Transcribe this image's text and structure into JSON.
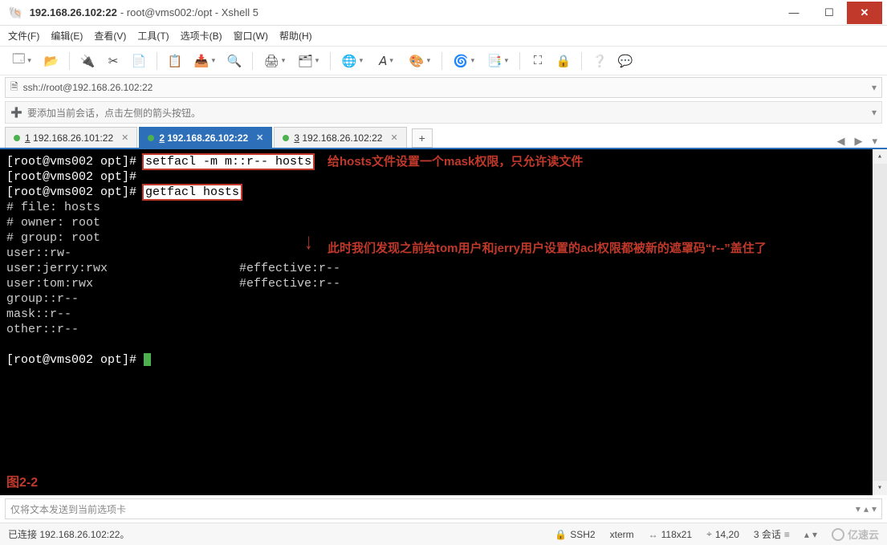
{
  "titlebar": {
    "host": "192.168.26.102:22",
    "subtitle": " - root@vms002:/opt - Xshell 5"
  },
  "menu": {
    "file": "文件(F)",
    "edit": "编辑(E)",
    "view": "查看(V)",
    "tools": "工具(T)",
    "tabs": "选项卡(B)",
    "window": "窗口(W)",
    "help": "帮助(H)"
  },
  "addressbar": {
    "url": "ssh://root@192.168.26.102:22"
  },
  "hintbar": {
    "text": "要添加当前会话，点击左侧的箭头按钮。"
  },
  "tabs": {
    "t0": {
      "prefix": "1",
      "label": " 192.168.26.101:22"
    },
    "t1": {
      "prefix": "2",
      "label": " 192.168.26.102:22"
    },
    "t2": {
      "prefix": "3",
      "label": " 192.168.26.102:22"
    }
  },
  "terminal": {
    "prompt1": "[root@vms002 opt]# ",
    "cmd1": "setfacl -m m::r-- hosts",
    "prompt2": "[root@vms002 opt]#",
    "prompt3": "[root@vms002 opt]# ",
    "cmd3": "getfacl hosts",
    "l_file": "# file: hosts",
    "l_owner": "# owner: root",
    "l_group": "# group: root",
    "l_user": "user::rw-",
    "l_jerry": "user:jerry:rwx",
    "l_jerry_eff": "#effective:r--",
    "l_tom": "user:tom:rwx",
    "l_tom_eff": "#effective:r--",
    "l_grp": "group::r--",
    "l_mask": "mask::r--",
    "l_other": "other::r--",
    "prompt4": "[root@vms002 opt]# ",
    "annotation1": "给hosts文件设置一个mask权限，只允许读文件",
    "annotation2": "此时我们发现之前给tom用户和jerry用户设置的acl权限都被新的遮罩码“r--”盖住了",
    "figlabel": "图2-2"
  },
  "inputrow": {
    "placeholder": "仅将文本发送到当前选项卡"
  },
  "statusbar": {
    "conn": "已连接 192.168.26.102:22。",
    "ssh": "SSH2",
    "term": "xterm",
    "size": "118x21",
    "pos": "14,20",
    "sessions": "3 会话",
    "watermark": "亿速云"
  }
}
